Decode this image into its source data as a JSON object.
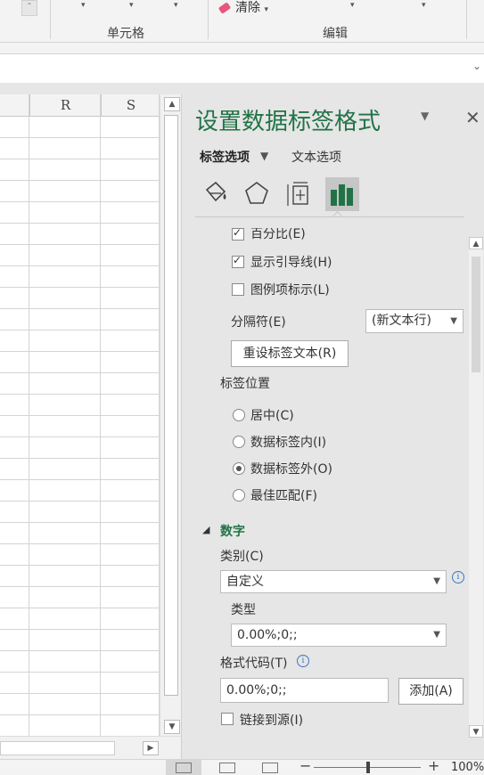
{
  "ribbon": {
    "cells_group_label": "单元格",
    "edit_group_label": "编辑",
    "clear_label": "清除",
    "dropdown_glyph": "▾",
    "scroll_glyph": "⌃"
  },
  "formula_bar": {
    "chevron": "⌄"
  },
  "grid": {
    "columns": [
      "R",
      "S"
    ],
    "scroll_up": "▲",
    "scroll_down": "▼",
    "scroll_right": "▶"
  },
  "pane": {
    "title": "设置数据标签格式",
    "menu_glyph": "▼",
    "close_glyph": "✕",
    "tabs": {
      "label_options": "标签选项",
      "text_options": "文本选项",
      "caret": "▼"
    },
    "icons": [
      "fill-line-icon",
      "effects-icon",
      "size-properties-icon",
      "label-options-chart-icon"
    ],
    "checkboxes": [
      {
        "label": "百分比(E)",
        "checked": true
      },
      {
        "label": "显示引导线(H)",
        "checked": true
      },
      {
        "label": "图例项标示(L)",
        "checked": false
      }
    ],
    "separator": {
      "label": "分隔符(E)",
      "value": "(新文本行)"
    },
    "reset_button": "重设标签文本(R)",
    "position": {
      "heading": "标签位置",
      "options": [
        {
          "label": "居中(C)",
          "selected": false
        },
        {
          "label": "数据标签内(I)",
          "selected": false
        },
        {
          "label": "数据标签外(O)",
          "selected": true
        },
        {
          "label": "最佳匹配(F)",
          "selected": false
        }
      ]
    },
    "number": {
      "section_title": "数字",
      "collapse_glyph": "◢",
      "category_label": "类别(C)",
      "category_value": "自定义",
      "type_label": "类型",
      "type_value": "0.00%;0;;",
      "format_code_label": "格式代码(T)",
      "format_code_value": "0.00%;0;;",
      "add_button": "添加(A)",
      "link_source_label": "链接到源(I)",
      "link_source_checked": false,
      "info_glyph": "i"
    },
    "scroll_up": "▲",
    "scroll_down": "▼"
  },
  "status": {
    "zoom_minus": "−",
    "zoom_plus": "+",
    "zoom_level": "100%"
  }
}
